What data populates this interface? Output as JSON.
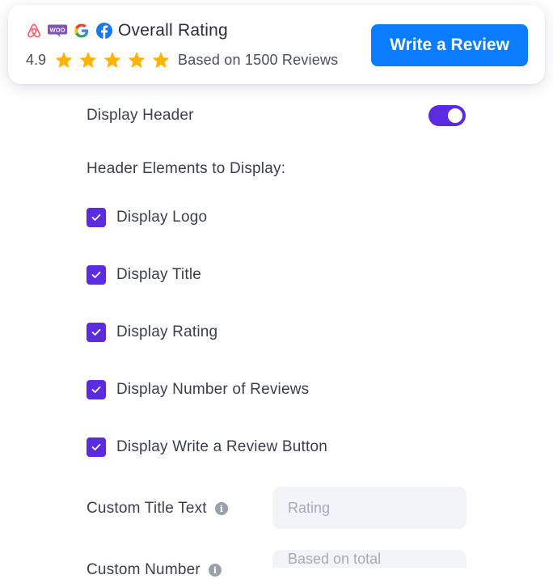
{
  "header_preview": {
    "logos": [
      "airbnb-icon",
      "woo-icon",
      "google-icon",
      "facebook-icon"
    ],
    "woo_text": "WOO",
    "google_letter": "G",
    "facebook_letter": "f",
    "title": "Overall Rating",
    "rating_value": "4.9",
    "stars": 5,
    "based_on": "Based on 1500 Reviews",
    "write_review_label": "Write a Review"
  },
  "settings": {
    "display_header": {
      "label": "Display Header",
      "enabled": true
    },
    "elements_heading": "Header Elements to Display:",
    "elements": [
      {
        "label": "Display Logo",
        "checked": true
      },
      {
        "label": "Display Title",
        "checked": true
      },
      {
        "label": "Display Rating",
        "checked": true
      },
      {
        "label": "Display Number of Reviews",
        "checked": true
      },
      {
        "label": "Display Write a Review Button",
        "checked": true
      }
    ],
    "custom_title": {
      "label": "Custom Title Text",
      "placeholder": "Rating"
    },
    "custom_number": {
      "label": "Custom Number",
      "placeholder": "Based on total"
    }
  },
  "colors": {
    "accent": "#5b2be0",
    "button": "#0a7cff",
    "star": "#ffb300",
    "airbnb": "#ff5a5f",
    "woo": "#7f54b3",
    "facebook": "#1877f2"
  }
}
